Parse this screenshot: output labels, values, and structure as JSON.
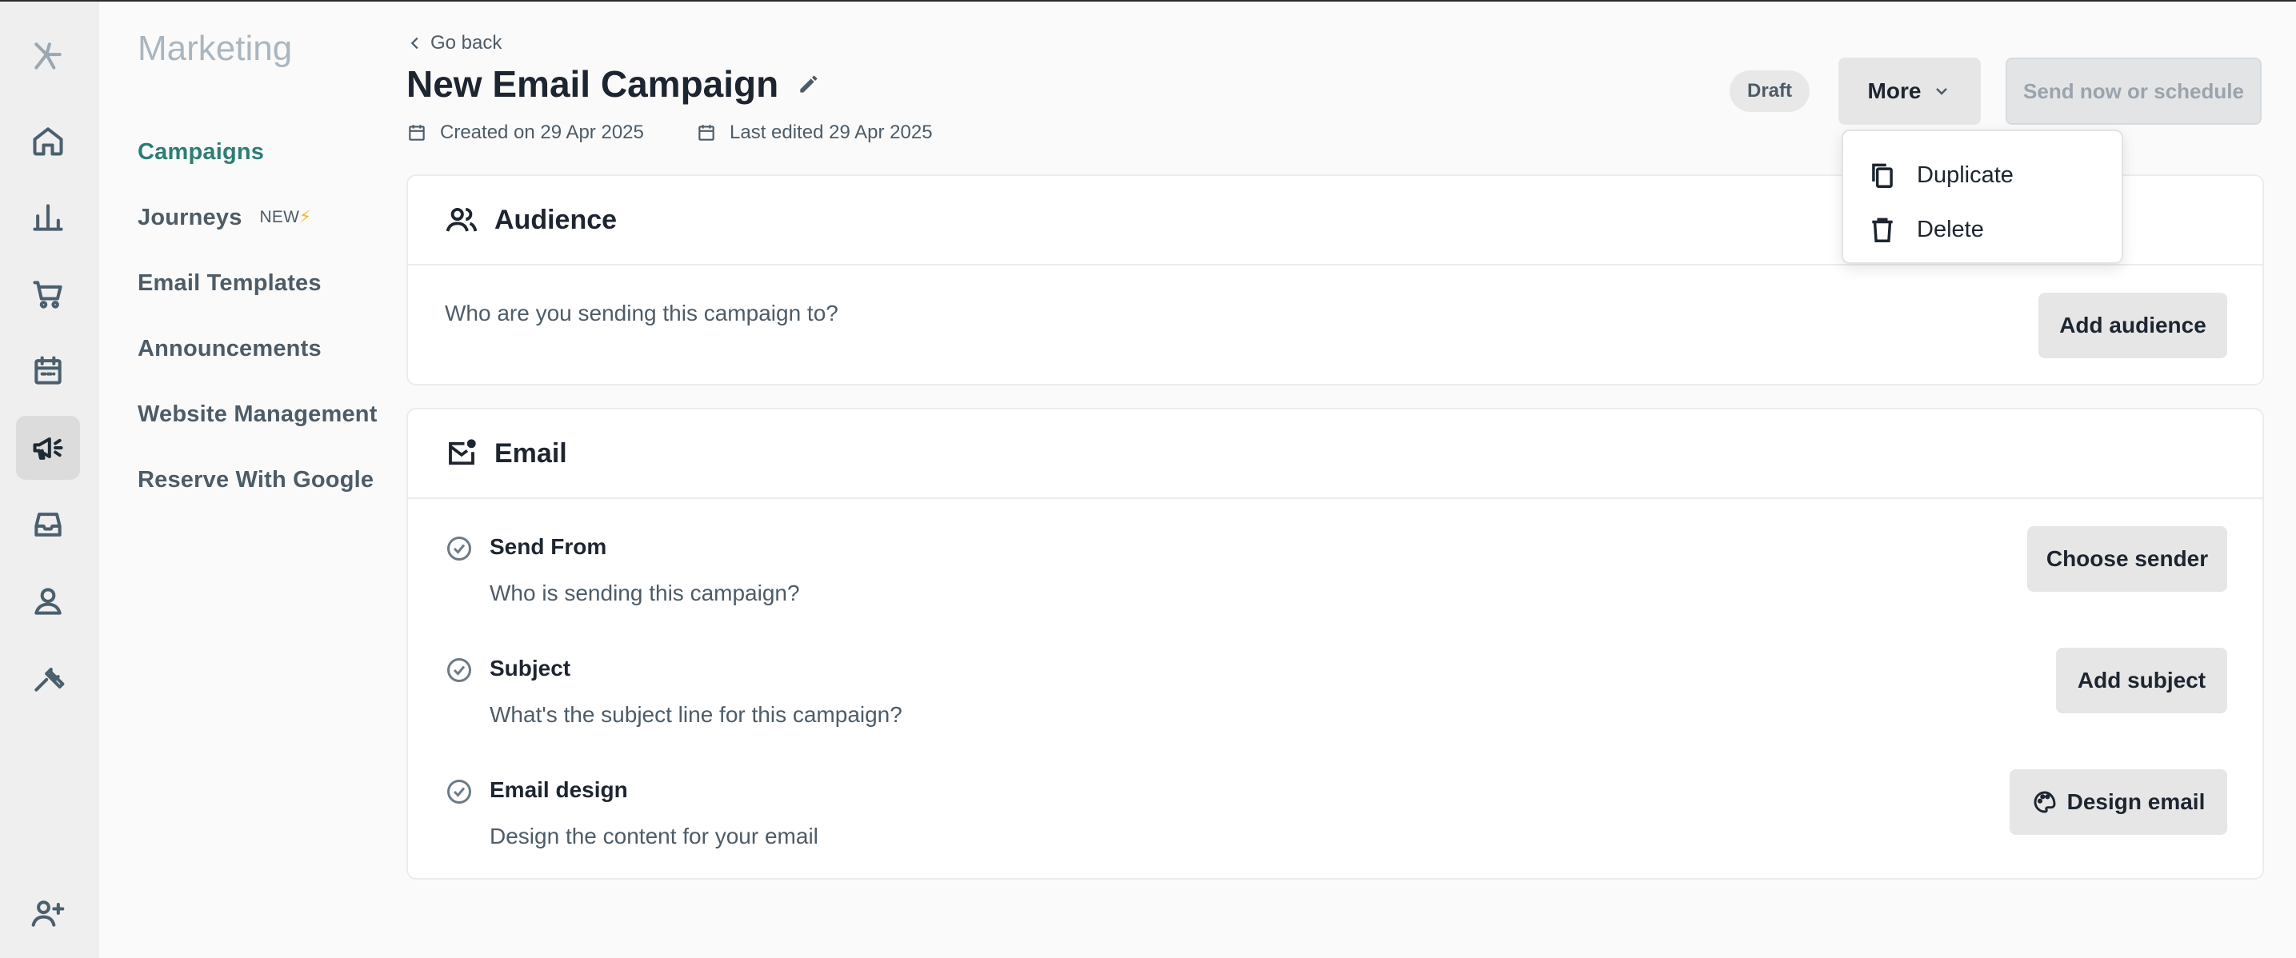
{
  "rail": {
    "items": [
      {
        "name": "home-icon"
      },
      {
        "name": "chart-icon"
      },
      {
        "name": "cart-icon"
      },
      {
        "name": "calendar-icon"
      },
      {
        "name": "megaphone-icon"
      },
      {
        "name": "inbox-icon"
      },
      {
        "name": "person-icon"
      },
      {
        "name": "wrench-icon"
      },
      {
        "name": "add-user-icon"
      }
    ]
  },
  "subnav": {
    "title": "Marketing",
    "items": [
      {
        "label": "Campaigns"
      },
      {
        "label": "Journeys",
        "badge": "NEW",
        "badge_icon": "⚡"
      },
      {
        "label": "Email Templates"
      },
      {
        "label": "Announcements"
      },
      {
        "label": "Website Management"
      },
      {
        "label": "Reserve With Google"
      }
    ]
  },
  "header": {
    "go_back": "Go back",
    "title": "New Email Campaign",
    "created": "Created on 29 Apr 2025",
    "last_edited": "Last edited 29 Apr 2025",
    "status": "Draft",
    "more_label": "More",
    "send_label": "Send now or schedule"
  },
  "more_menu": {
    "items": [
      {
        "label": "Duplicate",
        "icon": "duplicate-icon"
      },
      {
        "label": "Delete",
        "icon": "trash-icon"
      }
    ]
  },
  "audience": {
    "title": "Audience",
    "prompt": "Who are you sending this campaign to?",
    "button": "Add audience"
  },
  "email": {
    "title": "Email",
    "rows": [
      {
        "title": "Send From",
        "subtitle": "Who is sending this campaign?",
        "button": "Choose sender"
      },
      {
        "title": "Subject",
        "subtitle": "What's the subject line for this campaign?",
        "button": "Add subject"
      },
      {
        "title": "Email design",
        "subtitle": "Design the content for your email",
        "button": "Design email"
      }
    ]
  },
  "colors": {
    "accent": "#2e7d74",
    "rail_bg": "#efefef",
    "button_bg": "#e6e6e6"
  }
}
